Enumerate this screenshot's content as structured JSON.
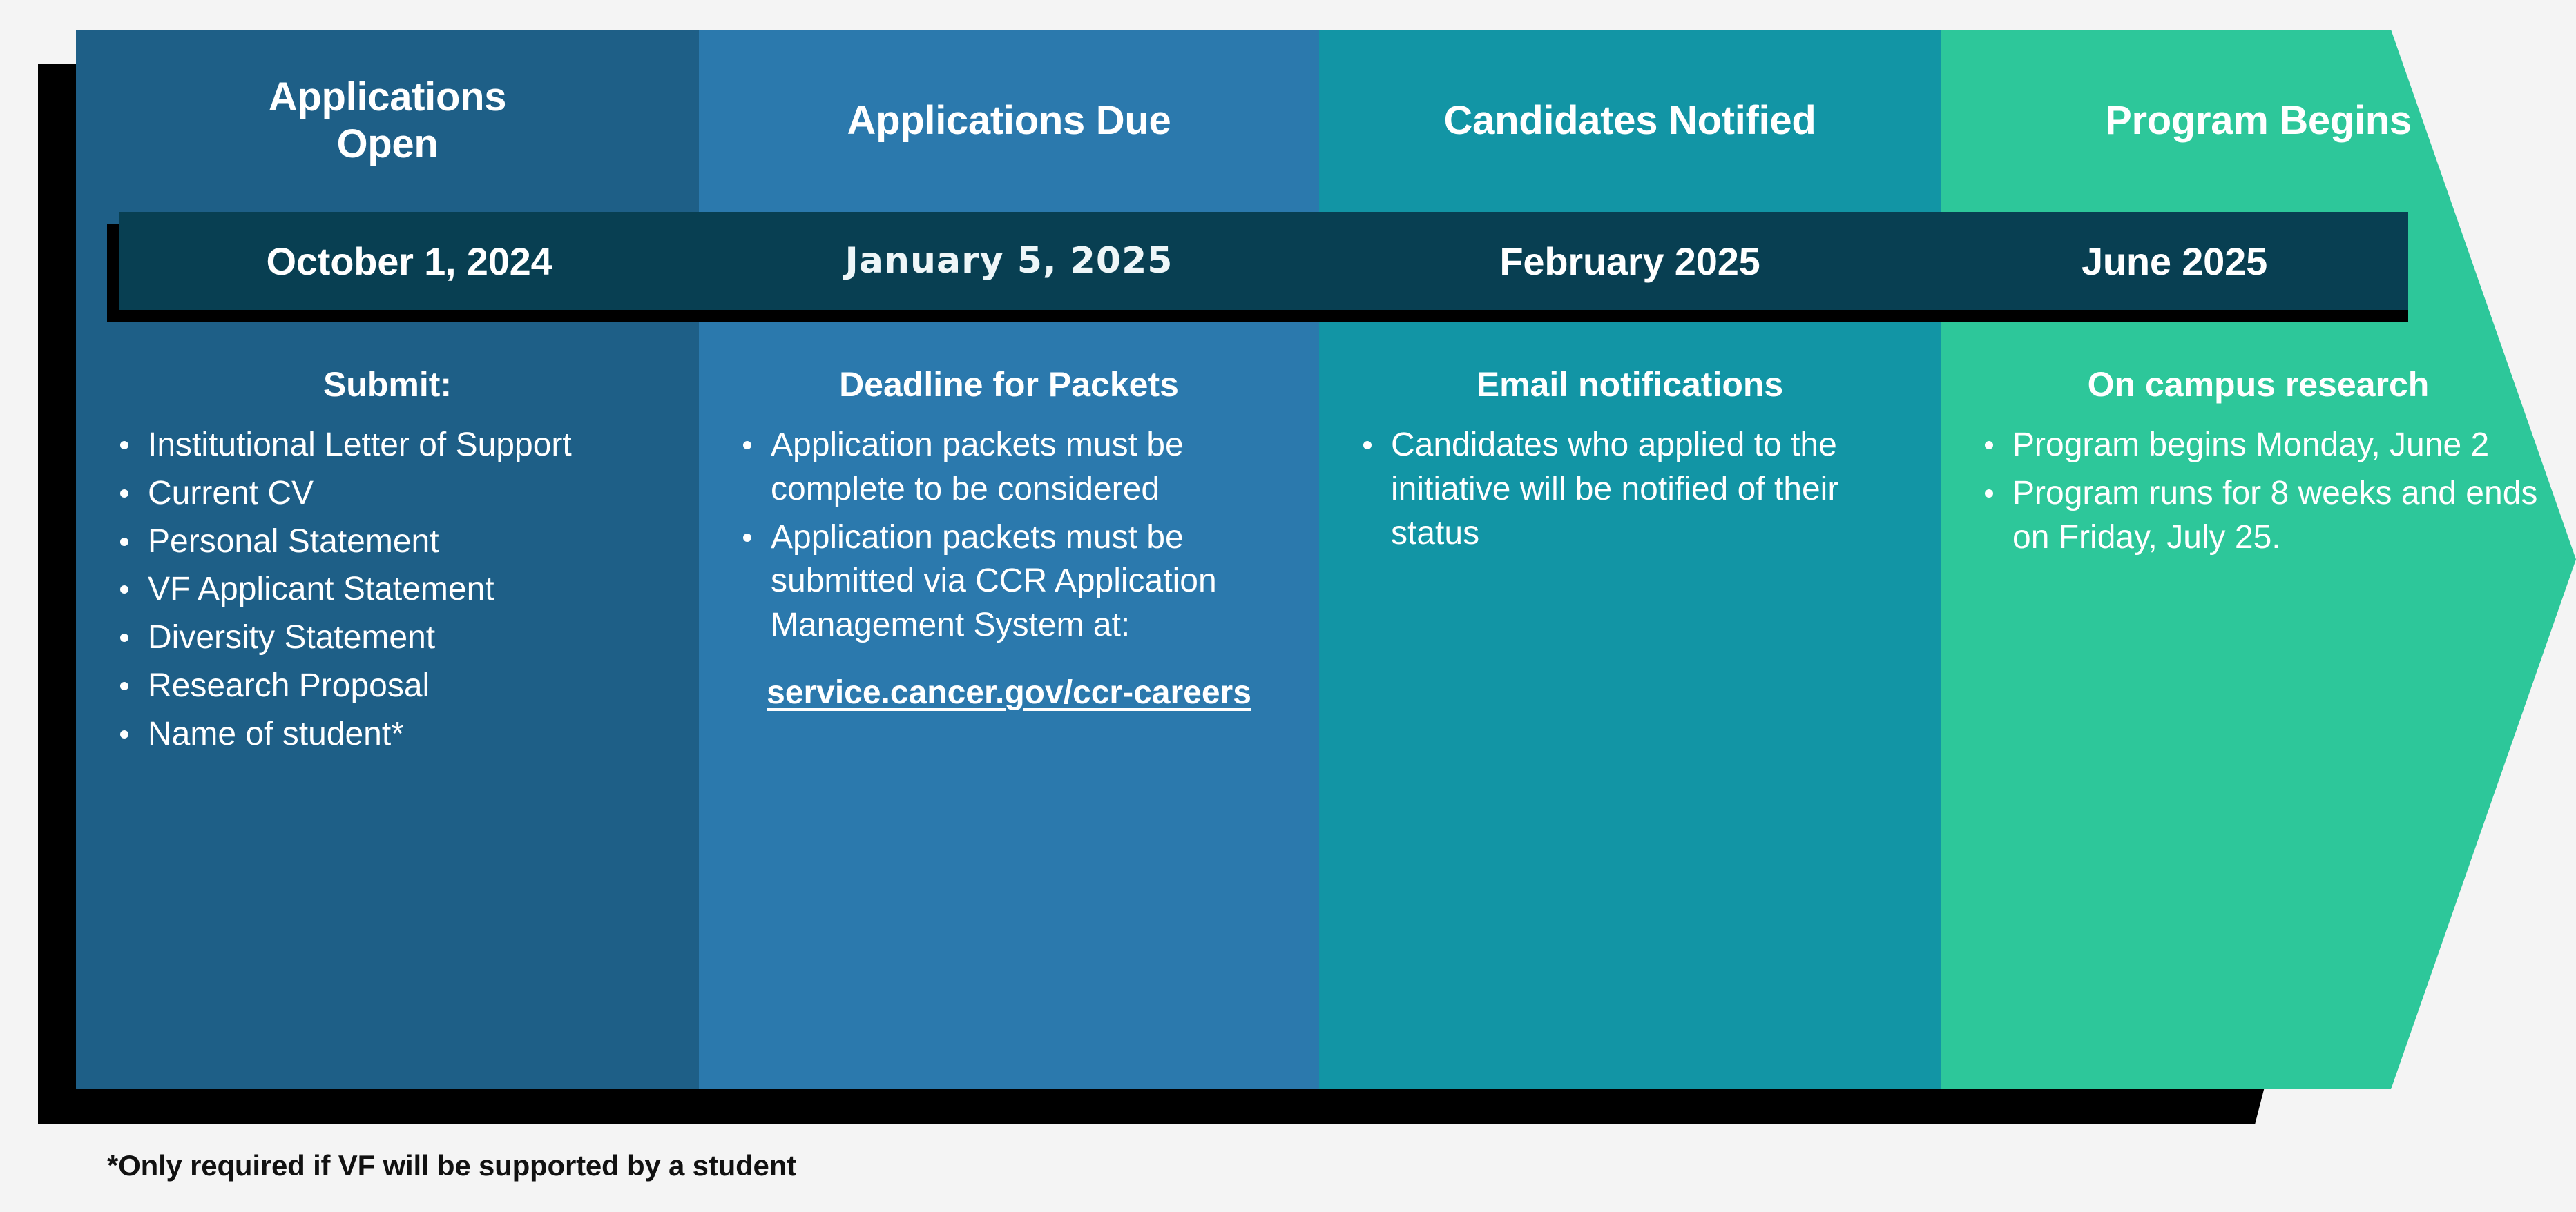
{
  "theme": {
    "page_background": "#f4f4f4",
    "column_colors": [
      "#1e5f87",
      "#2b79ad",
      "#1295a5",
      "#2dc79a"
    ],
    "date_band_color": "#083f52",
    "shadow_color": "#000000",
    "text_color": "#ffffff",
    "footnote_color": "#111111"
  },
  "timeline": {
    "columns": [
      {
        "stage": "Applications Open",
        "date": "October 1, 2024",
        "body_title": "Submit:",
        "bullets": [
          "Institutional Letter of Support",
          "Current CV",
          "Personal Statement",
          "VF Applicant Statement",
          "Diversity Statement",
          "Research Proposal",
          "Name of student*"
        ],
        "link_text": ""
      },
      {
        "stage": "Applications Due",
        "date": "January 5, 2025",
        "body_title": "Deadline for Packets",
        "bullets": [
          "Application packets must be complete to be considered",
          "Application packets must be submitted via CCR Application Management System at:"
        ],
        "link_text": "service.cancer.gov/ccr-careers"
      },
      {
        "stage": "Candidates Notified",
        "date": "February 2025",
        "body_title": "Email notifications",
        "bullets": [
          "Candidates who applied to the initiative will be notified of their status"
        ],
        "link_text": ""
      },
      {
        "stage": "Program Begins",
        "date": "June 2025",
        "body_title": "On campus research",
        "bullets": [
          "Program begins Monday, June 2",
          "Program runs for 8 weeks and ends on Friday, July 25."
        ],
        "link_text": ""
      }
    ]
  },
  "footnote": "*Only required if VF will be supported by a student"
}
